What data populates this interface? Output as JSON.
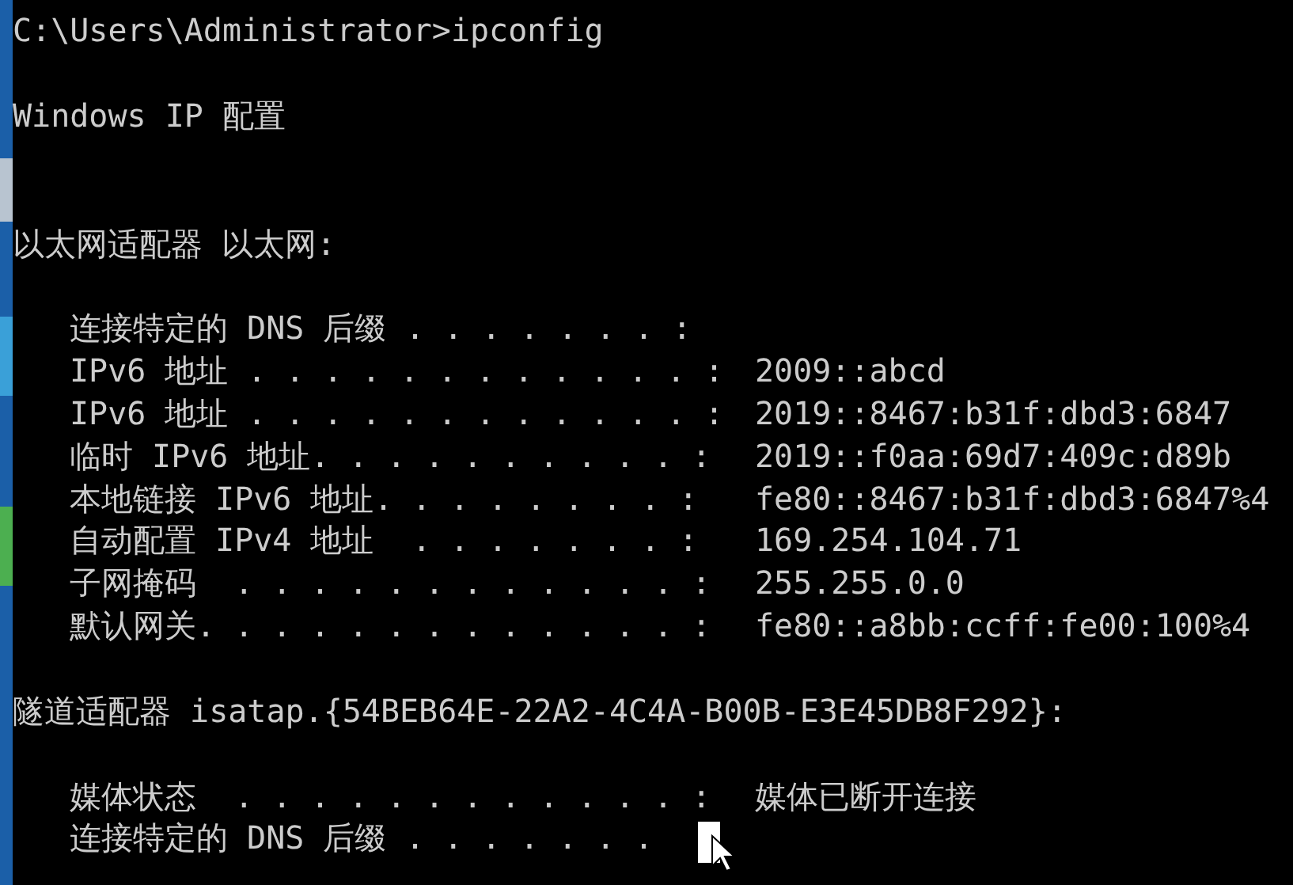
{
  "window": {
    "kind": "console"
  },
  "command_line": "C:\\Users\\Administrator>ipconfig",
  "heading": "Windows IP 配置",
  "adapters": [
    {
      "title": "以太网适配器 以太网:",
      "entries": [
        {
          "label": "连接特定的 DNS 后缀 . . . . . . . :"
        },
        {
          "label": "IPv6 地址 . . . . . . . . . . . . :",
          "value": "2009::abcd"
        },
        {
          "label": "IPv6 地址 . . . . . . . . . . . . :",
          "value": "2019::8467:b31f:dbd3:6847"
        },
        {
          "label": "临时 IPv6 地址. . . . . . . . . . :",
          "value": "2019::f0aa:69d7:409c:d89b"
        },
        {
          "label": "本地链接 IPv6 地址. . . . . . . . :",
          "value": "fe80::8467:b31f:dbd3:6847%4"
        },
        {
          "label": "自动配置 IPv4 地址  . . . . . . . :",
          "value": "169.254.104.71"
        },
        {
          "label": "子网掩码  . . . . . . . . . . . . :",
          "value": "255.255.0.0"
        },
        {
          "label": "默认网关. . . . . . . . . . . . . :",
          "value": "fe80::a8bb:ccff:fe00:100%4"
        }
      ]
    },
    {
      "title": "隧道适配器 isatap.{54BEB64E-22A2-4C4A-B00B-E3E45DB8F292}:",
      "entries": [
        {
          "label": "媒体状态  . . . . . . . . . . . . :",
          "value": "媒体已断开连接"
        },
        {
          "label": "连接特定的 DNS 后缀 . . . . . . ."
        }
      ]
    }
  ]
}
